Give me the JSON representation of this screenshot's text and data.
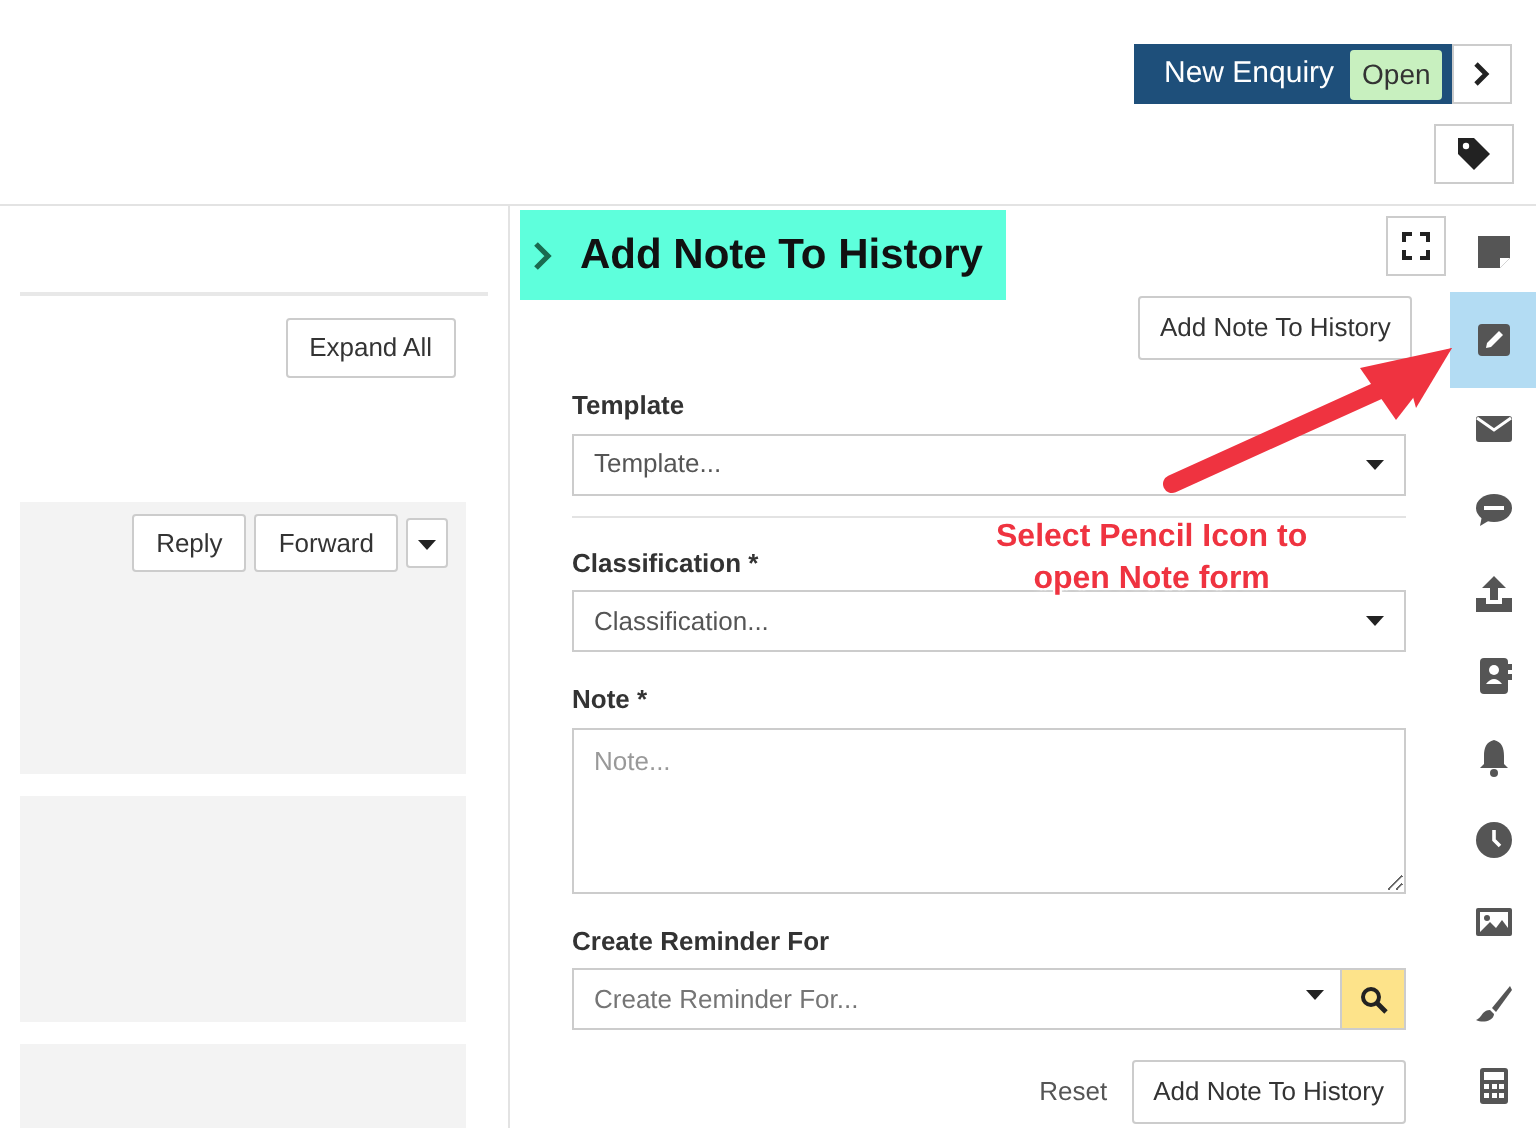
{
  "enquiry": {
    "title": "New Enquiry",
    "status": "Open"
  },
  "history": {
    "expand_button": "Expand All",
    "message_actions": [
      "Reply",
      "Forward"
    ]
  },
  "note_panel": {
    "title": "Add Note To History",
    "top_button": "Add Note To History",
    "fields": [
      {
        "kind": "select",
        "label": "Template",
        "placeholder": "Template..."
      },
      {
        "kind": "select",
        "label": "Classification *",
        "placeholder": "Classification..."
      },
      {
        "kind": "textarea",
        "label": "Note *",
        "placeholder": "Note..."
      },
      {
        "kind": "lookup",
        "label": "Create Reminder For",
        "placeholder": "Create Reminder For..."
      }
    ],
    "reset_link": "Reset",
    "submit_button": "Add Note To History"
  },
  "rail_icons": [
    {
      "kind": "sticky-note",
      "selected": false
    },
    {
      "kind": "pencil",
      "selected": true
    },
    {
      "kind": "envelope",
      "selected": false
    },
    {
      "kind": "sms",
      "selected": false
    },
    {
      "kind": "upload",
      "selected": false
    },
    {
      "kind": "contact-book",
      "selected": false
    },
    {
      "kind": "bell",
      "selected": false
    },
    {
      "kind": "clock",
      "selected": false
    },
    {
      "kind": "image",
      "selected": false
    },
    {
      "kind": "brush",
      "selected": false
    },
    {
      "kind": "calculator",
      "selected": false
    }
  ],
  "annotation": {
    "lines": [
      "Select Pencil Icon to",
      "open Note form"
    ]
  }
}
